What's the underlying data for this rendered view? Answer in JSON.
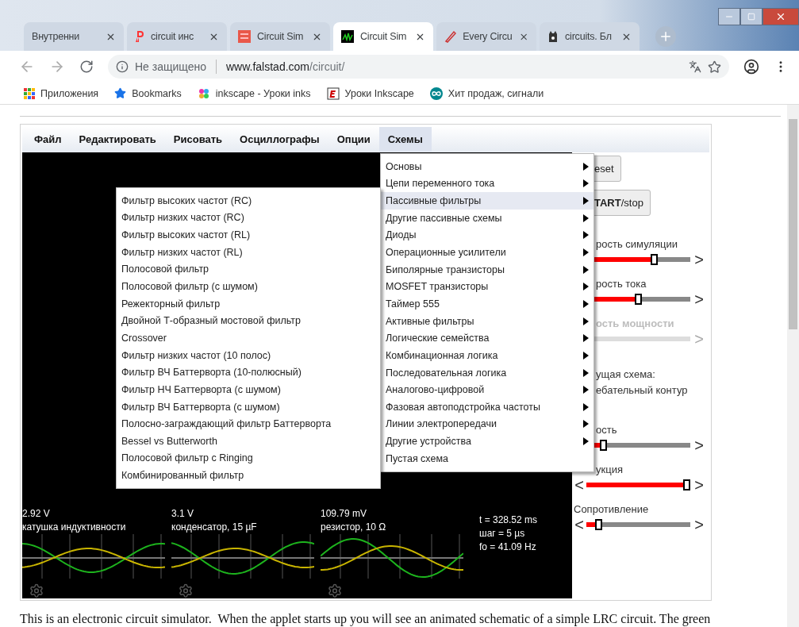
{
  "browser": {
    "tabs": [
      {
        "title": "Внутренни",
        "selected": false
      },
      {
        "title": "circuit инс",
        "selected": false
      },
      {
        "title": "Circuit Sim",
        "selected": false
      },
      {
        "title": "Circuit Sim",
        "selected": true
      },
      {
        "title": "Every Circu",
        "selected": false
      },
      {
        "title": "circuits. Бл",
        "selected": false
      }
    ],
    "security": "Не защищено",
    "url_host": "www.falstad.com",
    "url_path": "/circuit/",
    "bookmarks": [
      {
        "label": "Приложения"
      },
      {
        "label": "Bookmarks"
      },
      {
        "label": "inkscape - Уроки inks"
      },
      {
        "label": "Уроки Inkscape"
      },
      {
        "label": "Хит продаж, сигнали"
      }
    ]
  },
  "menubar": [
    {
      "label": "Файл",
      "selected": false
    },
    {
      "label": "Редактировать",
      "selected": false
    },
    {
      "label": "Рисовать",
      "selected": false
    },
    {
      "label": "Осциллографы",
      "selected": false
    },
    {
      "label": "Опции",
      "selected": false
    },
    {
      "label": "Схемы",
      "selected": true
    }
  ],
  "menu": [
    {
      "label": "Основы",
      "submenu": true,
      "selected": false
    },
    {
      "label": "Цепи переменного тока",
      "submenu": true,
      "selected": false
    },
    {
      "label": "Пассивные фильтры",
      "submenu": true,
      "selected": true
    },
    {
      "label": "Другие пассивные схемы",
      "submenu": true,
      "selected": false
    },
    {
      "label": "Диоды",
      "submenu": true,
      "selected": false
    },
    {
      "label": "Операционные усилители",
      "submenu": true,
      "selected": false
    },
    {
      "label": "Биполярные транзисторы",
      "submenu": true,
      "selected": false
    },
    {
      "label": "MOSFET транзисторы",
      "submenu": true,
      "selected": false
    },
    {
      "label": "Таймер 555",
      "submenu": true,
      "selected": false
    },
    {
      "label": "Активные фильтры",
      "submenu": true,
      "selected": false
    },
    {
      "label": "Логические семейства",
      "submenu": true,
      "selected": false
    },
    {
      "label": "Комбинационная логика",
      "submenu": true,
      "selected": false
    },
    {
      "label": "Последовательная логика",
      "submenu": true,
      "selected": false
    },
    {
      "label": "Аналогово-цифровой",
      "submenu": true,
      "selected": false
    },
    {
      "label": "Фазовая автоподстройка частоты",
      "submenu": true,
      "selected": false
    },
    {
      "label": "Линии электропередачи",
      "submenu": true,
      "selected": false
    },
    {
      "label": "Другие устройства",
      "submenu": true,
      "selected": false
    },
    {
      "label": "Пустая схема",
      "submenu": false,
      "selected": false
    }
  ],
  "submenu": [
    "Фильтр высоких частот (RC)",
    "Фильтр низких частот (RC)",
    "Фильтр высоких частот (RL)",
    "Фильтр низких частот (RL)",
    "Полосовой фильтр",
    "Полосовой фильтр (с шумом)",
    "Режекторный фильтр",
    "Двойной Т-образный мостовой фильтр",
    "Crossover",
    "Фильтр низких частот (10 полос)",
    "Фильтр ВЧ Баттерворта (10-полюсный)",
    "Фильтр НЧ Баттерворта (с шумом)",
    "Фильтр ВЧ Баттерворта (с шумом)",
    "Полосно-заграждающий фильтр Баттерворта",
    "Bessel vs Butterworth",
    "Полосовой фильтр с Ringing",
    "Комбинированный фильтр"
  ],
  "scopes": [
    {
      "value": "2.92 V",
      "label": "катушка индуктивности"
    },
    {
      "value": "3.1 V",
      "label": "конденсатор, 15 µF"
    },
    {
      "value": "109.79 mV",
      "label": "резистор, 10 Ω"
    }
  ],
  "sim_info": [
    "t = 328.52 ms",
    "шаг = 5 µs",
    "fo = 41.09 Hz"
  ],
  "right_panel": [
    {
      "kind": "button",
      "label": "eset"
    },
    {
      "kind": "button",
      "label": "**TART**/stop"
    },
    {
      "kind": "slider",
      "label": "рость симуляции",
      "right_arrow": ">",
      "level": 0.66,
      "disabled": false
    },
    {
      "kind": "slider",
      "label": "рость тока",
      "right_arrow": ">",
      "level": 0.5,
      "disabled": false
    },
    {
      "kind": "slider",
      "label": "ость мощности",
      "right_arrow": ">",
      "disabled": true
    },
    {
      "kind": "text",
      "lines": [
        "ущая схема:",
        "ебательный контур"
      ]
    },
    {
      "kind": "slider",
      "label": "ость",
      "right_arrow": ">",
      "level": 0.14,
      "disabled": false
    },
    {
      "kind": "slider",
      "label": "укция",
      "left_arrow": "<",
      "right_arrow": ">",
      "level": 1,
      "disabled": false
    },
    {
      "kind": "slider",
      "label": "Сопротивление",
      "left_arrow": "<",
      "right_arrow": ">",
      "level": 0.09,
      "disabled": false
    }
  ],
  "intro": "This is an electronic circuit simulator.  When the applet starts up you will see an animated schematic of a simple LRC circuit. The green"
}
